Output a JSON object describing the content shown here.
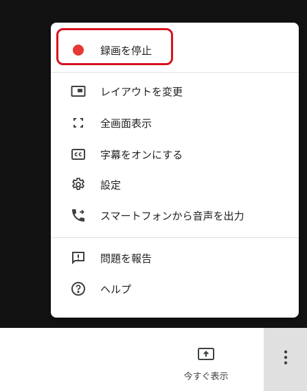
{
  "colors": {
    "highlight_border": "#d70f1c",
    "record_dot": "#e53935",
    "icon": "#3c4043",
    "more_button_bg": "#e0e0e0"
  },
  "menu": {
    "items": [
      {
        "icon": "record-dot-icon",
        "label": "録画を停止"
      },
      {
        "icon": "layout-icon",
        "label": "レイアウトを変更"
      },
      {
        "icon": "fullscreen-icon",
        "label": "全画面表示"
      },
      {
        "icon": "closed-captions-icon",
        "label": "字幕をオンにする"
      },
      {
        "icon": "gear-icon",
        "label": "設定"
      },
      {
        "icon": "phone-forward-icon",
        "label": "スマートフォンから音声を出力"
      },
      {
        "icon": "feedback-icon",
        "label": "問題を報告"
      },
      {
        "icon": "help-icon",
        "label": "ヘルプ"
      }
    ]
  },
  "bottom_bar": {
    "present_now_label": "今すぐ表示",
    "present_icon": "present-screen-icon",
    "more_icon": "more-vertical-icon"
  }
}
